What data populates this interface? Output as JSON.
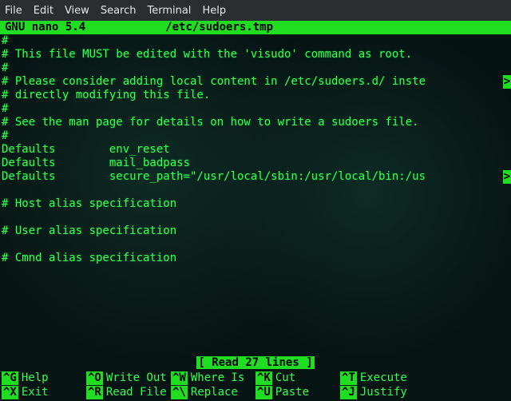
{
  "menu": [
    "File",
    "Edit",
    "View",
    "Search",
    "Terminal",
    "Help"
  ],
  "title": {
    "app": "GNU nano 5.4",
    "file": "/etc/sudoers.tmp"
  },
  "lines": [
    "#",
    "# This file MUST be edited with the 'visudo' command as root.",
    "#",
    "# Please consider adding local content in /etc/sudoers.d/ inste",
    "# directly modifying this file.",
    "#",
    "# See the man page for details on how to write a sudoers file.",
    "#",
    "Defaults        env_reset",
    "Defaults        mail_badpass",
    "Defaults        secure_path=\"/usr/local/sbin:/usr/local/bin:/us",
    "",
    "# Host alias specification",
    "",
    "# User alias specification",
    "",
    "# Cmnd alias specification",
    ""
  ],
  "overflow_rows": [
    3,
    10
  ],
  "overflow_char": ">",
  "status": "[ Read 27 lines ]",
  "shortcuts": [
    {
      "key": "^G",
      "label": "Help"
    },
    {
      "key": "^O",
      "label": "Write Out"
    },
    {
      "key": "^W",
      "label": "Where Is"
    },
    {
      "key": "^K",
      "label": "Cut"
    },
    {
      "key": "^T",
      "label": "Execute"
    },
    {
      "key": "",
      "label": ""
    },
    {
      "key": "^X",
      "label": "Exit"
    },
    {
      "key": "^R",
      "label": "Read File"
    },
    {
      "key": "^\\",
      "label": "Replace"
    },
    {
      "key": "^U",
      "label": "Paste"
    },
    {
      "key": "^J",
      "label": "Justify"
    },
    {
      "key": "",
      "label": ""
    }
  ]
}
